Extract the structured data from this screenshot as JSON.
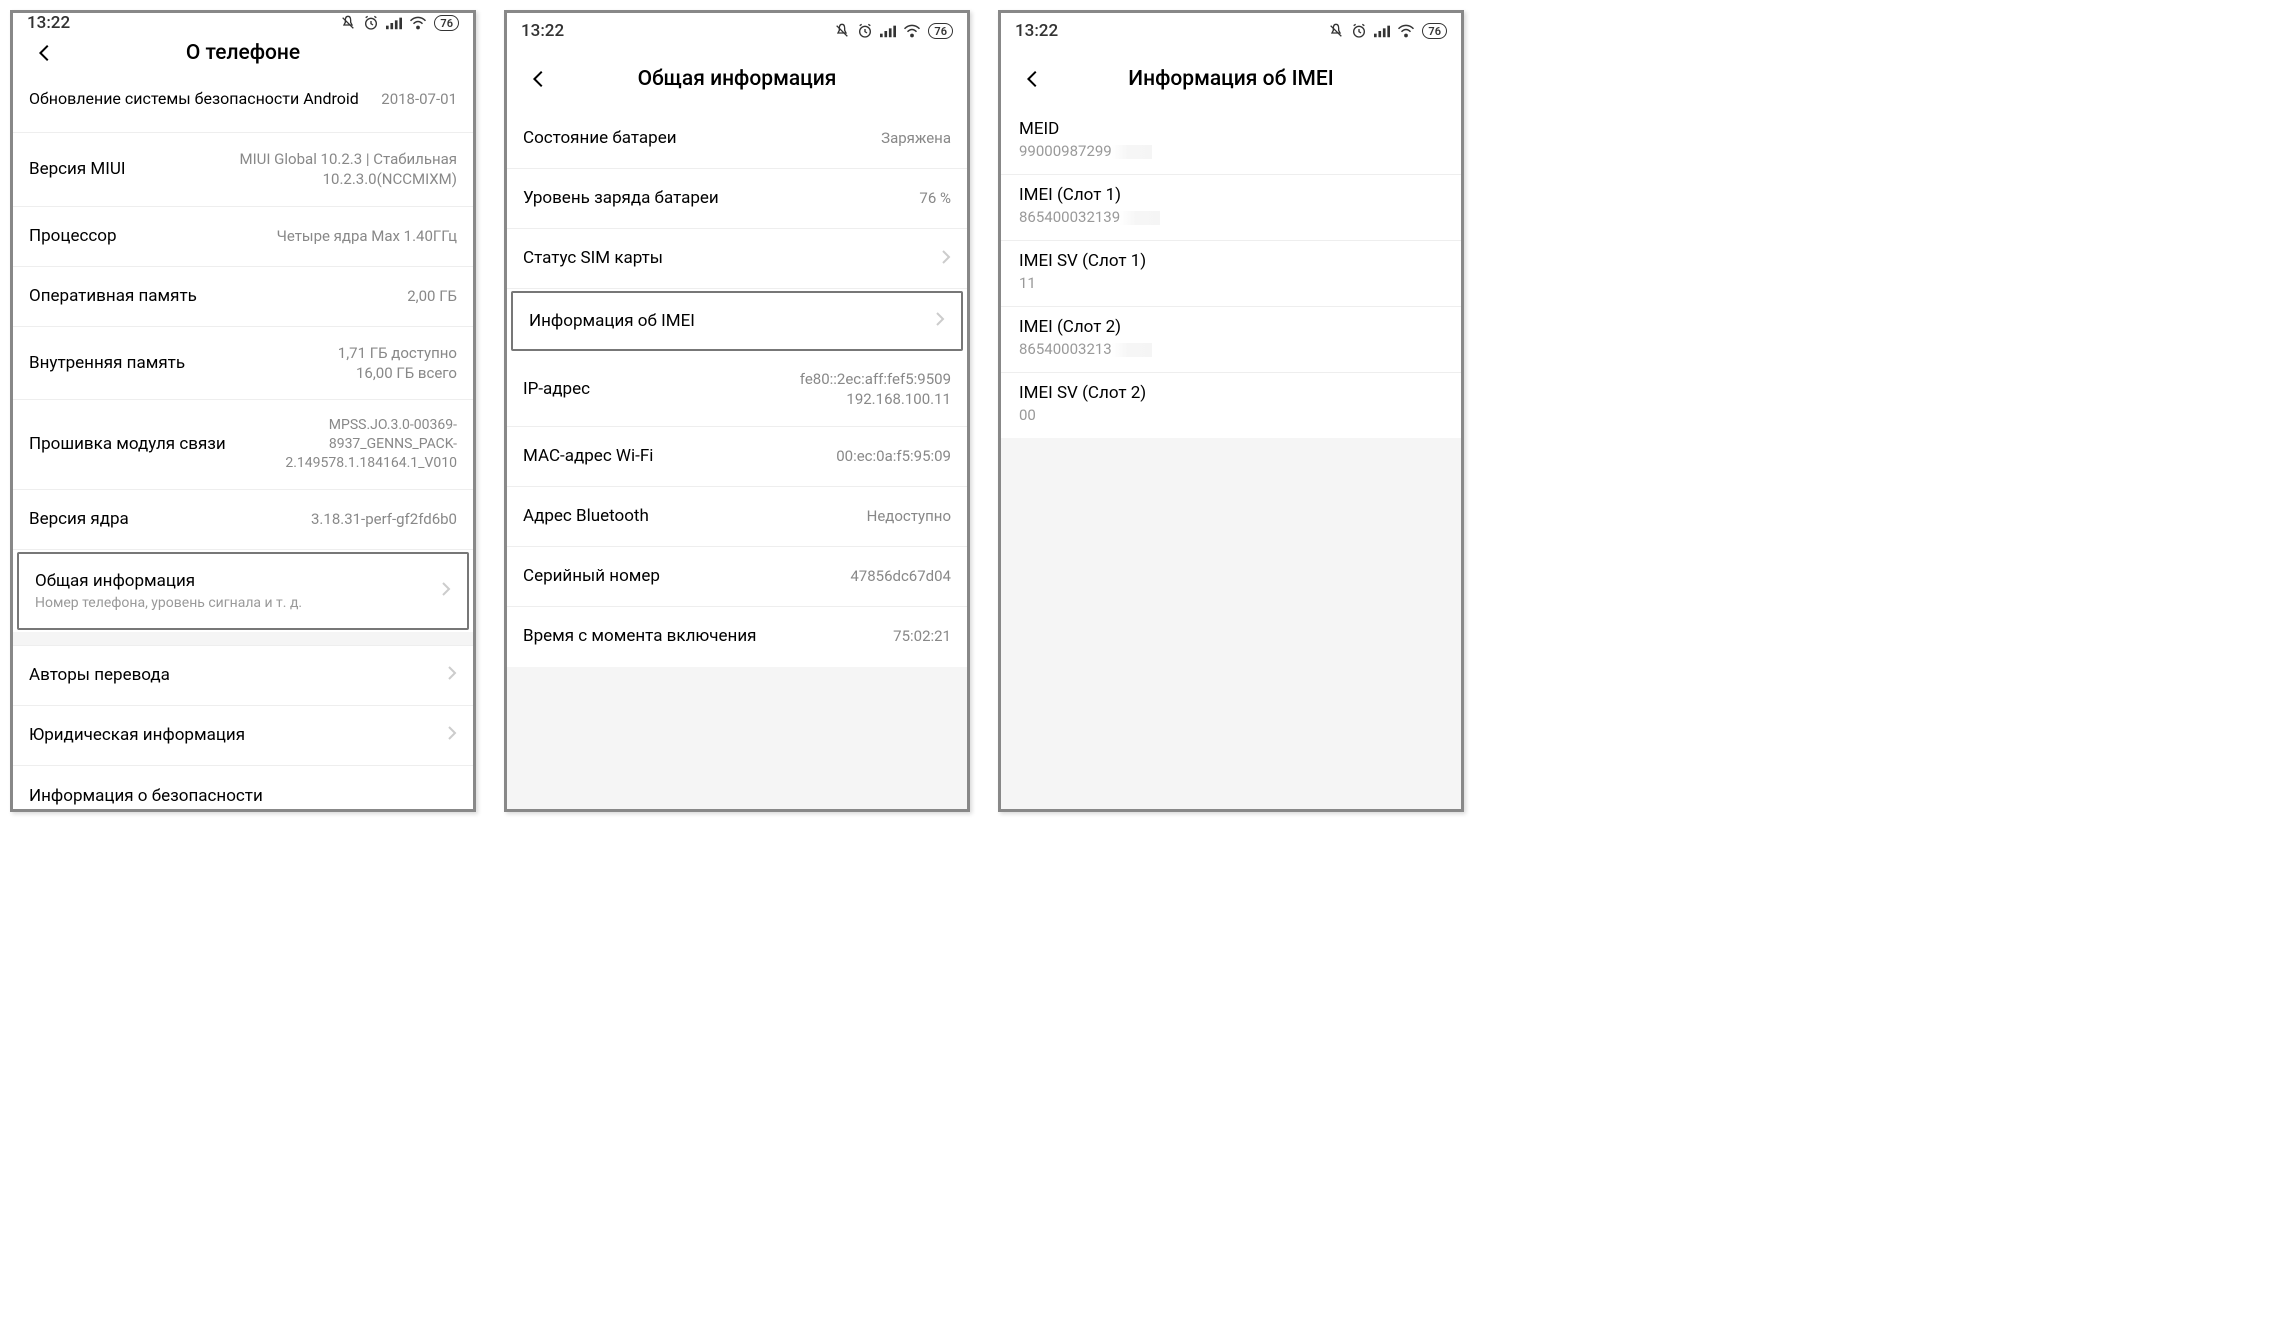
{
  "statusbar": {
    "time": "13:22",
    "battery": "76"
  },
  "phone1": {
    "title": "О телефоне",
    "rows": {
      "security_update": {
        "label": "Обновление системы безопасности Android",
        "value": "2018-07-01"
      },
      "miui": {
        "label": "Версия MIUI",
        "value": "MIUI Global 10.2.3 | Стабильная\n10.2.3.0(NCCMIXM)"
      },
      "cpu": {
        "label": "Процессор",
        "value": "Четыре ядра Max 1.40ГГц"
      },
      "ram": {
        "label": "Оперативная память",
        "value": "2,00 ГБ"
      },
      "storage": {
        "label": "Внутренняя память",
        "value": "1,71 ГБ доступно\n16,00 ГБ всего"
      },
      "baseband": {
        "label": "Прошивка модуля связи",
        "value": "MPSS.JO.3.0-00369-8937_GENNS_PACK-2.149578.1.184164.1_V010"
      },
      "kernel": {
        "label": "Версия ядра",
        "value": "3.18.31-perf-gf2fd6b0"
      },
      "status": {
        "label": "Общая информация",
        "sub": "Номер телефона, уровень сигнала и т. д."
      },
      "translators": {
        "label": "Авторы перевода"
      },
      "legal": {
        "label": "Юридическая информация"
      },
      "safety": {
        "label": "Информация о безопасности"
      }
    }
  },
  "phone2": {
    "title": "Общая информация",
    "rows": {
      "battery_status": {
        "label": "Состояние батареи",
        "value": "Заряжена"
      },
      "battery_level": {
        "label": "Уровень заряда батареи",
        "value": "76 %"
      },
      "sim": {
        "label": "Статус SIM карты"
      },
      "imei": {
        "label": "Информация об IMEI"
      },
      "ip": {
        "label": "IP-адрес",
        "value": "fe80::2ec:aff:fef5:9509\n192.168.100.11"
      },
      "mac": {
        "label": "MAC-адрес Wi-Fi",
        "value": "00:ec:0a:f5:95:09"
      },
      "bt": {
        "label": "Адрес Bluetooth",
        "value": "Недоступно"
      },
      "serial": {
        "label": "Серийный номер",
        "value": "47856dc67d04"
      },
      "uptime": {
        "label": "Время с момента включения",
        "value": "75:02:21"
      }
    }
  },
  "phone3": {
    "title": "Информация об IMEI",
    "rows": {
      "meid": {
        "label": "MEID",
        "value": "99000987299"
      },
      "imei1": {
        "label": "IMEI (Слот 1)",
        "value": "865400032139"
      },
      "imeisv1": {
        "label": "IMEI SV (Слот 1)",
        "value": "11"
      },
      "imei2": {
        "label": "IMEI (Слот 2)",
        "value": "86540003213"
      },
      "imeisv2": {
        "label": "IMEI SV (Слот 2)",
        "value": "00"
      }
    }
  }
}
